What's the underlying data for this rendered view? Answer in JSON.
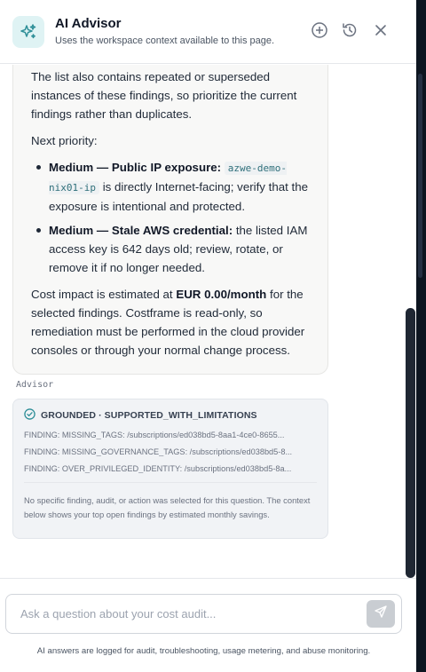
{
  "header": {
    "title": "AI Advisor",
    "subtitle": "Uses the workspace context available to this page.",
    "icons": [
      "sparkle-icon",
      "plus-circle-icon",
      "history-icon",
      "close-icon"
    ]
  },
  "message": {
    "p1": "The list also contains repeated or superseded instances of these findings, so prioritize the current findings rather than duplicates.",
    "p2": "Next priority:",
    "items": [
      {
        "bold": "Medium — Public IP exposure:",
        "code": "azwe-demo-nix01-ip",
        "text": "is directly Internet-facing; verify that the exposure is intentional and protected."
      },
      {
        "bold": "Medium — Stale AWS credential:",
        "text": "the listed IAM access key is 642 days old; review, rotate, or remove it if no longer needed."
      }
    ],
    "p3_pre": "Cost impact is estimated at",
    "p3_bold": "EUR 0.00/month",
    "p3_post": "for the selected findings. Costframe is read-only, so remediation must be performed in the cloud provider consoles or through your normal change process.",
    "role_label": "Advisor"
  },
  "grounding": {
    "status": "GROUNDED · SUPPORTED_WITH_LIMITATIONS",
    "findings": [
      "FINDING: MISSING_TAGS: /subscriptions/ed038bd5-8aa1-4ce0-8655...",
      "FINDING: MISSING_GOVERNANCE_TAGS: /subscriptions/ed038bd5-8...",
      "FINDING: OVER_PRIVILEGED_IDENTITY: /subscriptions/ed038bd5-8a..."
    ],
    "note": "No specific finding, audit, or action was selected for this question. The context below shows your top open findings by estimated monthly savings."
  },
  "composer": {
    "placeholder": "Ask a question about your cost audit...",
    "value": "",
    "footer": "AI answers are logged for audit, troubleshooting, usage metering, and abuse monitoring."
  },
  "colors": {
    "accent": "#2f8f98",
    "logo_bg": "#dff3f4",
    "send_disabled": "#c9cdd2"
  }
}
